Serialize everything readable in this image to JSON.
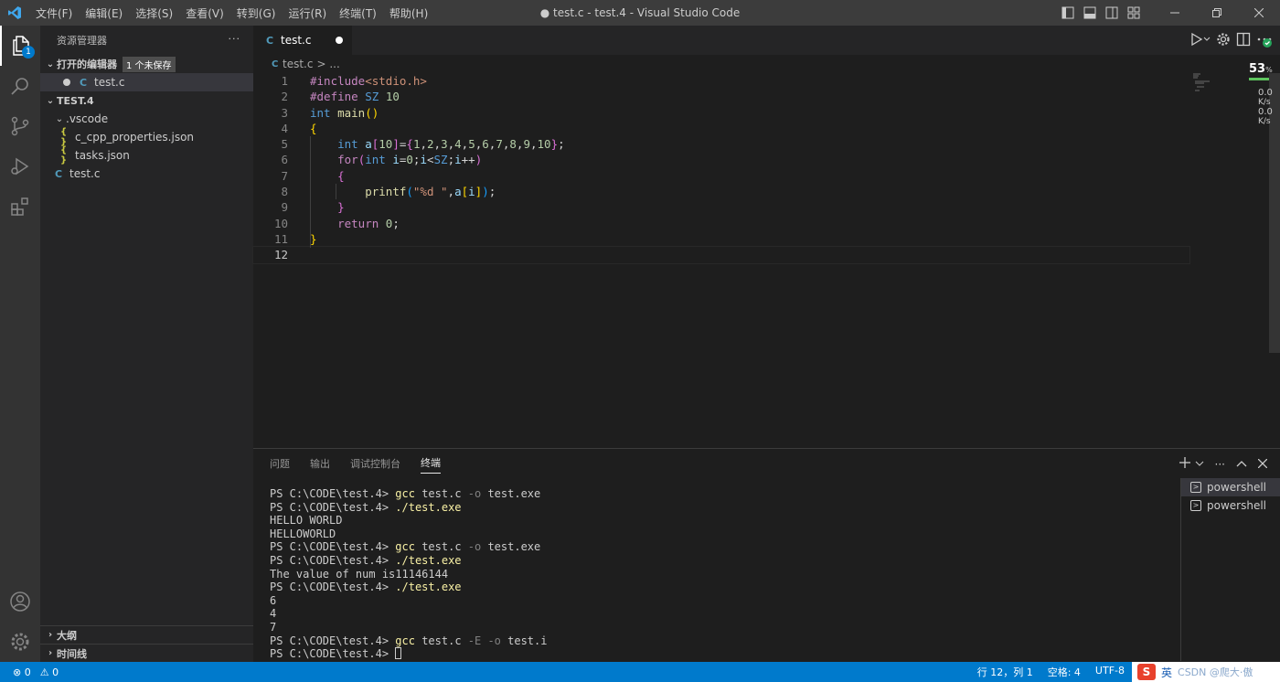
{
  "titlebar": {
    "menu": [
      "文件(F)",
      "编辑(E)",
      "选择(S)",
      "查看(V)",
      "转到(G)",
      "运行(R)",
      "终端(T)",
      "帮助(H)"
    ],
    "title": "● test.c - test.4 - Visual Studio Code"
  },
  "activity": {
    "explorer_badge": "1"
  },
  "sidebar": {
    "header": "资源管理器",
    "open_editors": {
      "label": "打开的编辑器",
      "badge": "1 个未保存",
      "file": "test.c"
    },
    "folder": {
      "label": "TEST.4",
      "vscode": ".vscode",
      "files": [
        "c_cpp_properties.json",
        "tasks.json"
      ],
      "root_file": "test.c"
    },
    "outline": "大纲",
    "timeline": "时间线"
  },
  "editor": {
    "tab": "test.c",
    "breadcrumb_file": "test.c",
    "breadcrumb_sep": "> ...",
    "line_numbers": [
      "1",
      "2",
      "3",
      "4",
      "5",
      "6",
      "7",
      "8",
      "9",
      "10",
      "11",
      "12"
    ]
  },
  "net": {
    "pct": "53",
    "pct_unit": "%",
    "up": "0.0",
    "up_unit": "K/s",
    "down": "0.0",
    "down_unit": "K/s"
  },
  "panel": {
    "tabs": [
      "问题",
      "输出",
      "调试控制台",
      "终端"
    ],
    "terminal_list": [
      "powershell",
      "powershell"
    ]
  },
  "status": {
    "errors": "0",
    "warnings": "0",
    "position": "行 12，列 1",
    "spaces": "空格: 4",
    "encoding": "UTF-8",
    "ime_lang": "英",
    "ime_extra": "CSDN @爬大·傲"
  },
  "colors": {
    "accent": "#007acc",
    "background": "#1e1e1e",
    "sidebar": "#252526",
    "activity": "#333333",
    "titlebar": "#3c3c3c"
  }
}
